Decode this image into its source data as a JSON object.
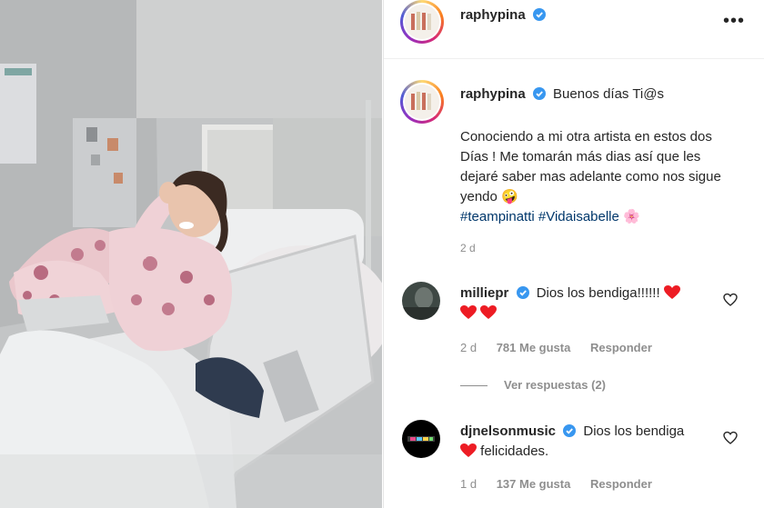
{
  "post": {
    "author": "raphypina",
    "caption_intro": "Buenos días Ti@s",
    "caption_body": "Conociendo a mi otra artista en estos dos Días ! Me tomarán más dias así que les dejaré saber mas adelante como nos sigue yendo",
    "caption_emoji": "🤪",
    "hashtags": [
      "#teampinatti",
      "#Vidaisabelle"
    ],
    "hashtag_emoji": "🌸",
    "time_ago": "2 d",
    "more_icon": "ellipsis-icon"
  },
  "comments": [
    {
      "username": "milliepr",
      "text": "Dios los bendiga!!!!!!",
      "hearts": 3,
      "time_ago": "2 d",
      "likes": "781 Me gusta",
      "reply_label": "Responder",
      "view_replies": "Ver respuestas (2)"
    },
    {
      "username": "djnelsonmusic",
      "text_after_heart": "felicidades.",
      "text": "Dios los bendiga",
      "time_ago": "1 d",
      "likes": "137 Me gusta",
      "reply_label": "Responder"
    }
  ],
  "colors": {
    "verified_blue": "#3897f0",
    "hashtag_blue": "#00376b",
    "heart_red": "#ed1c24",
    "muted_text": "#8e8e8e"
  }
}
